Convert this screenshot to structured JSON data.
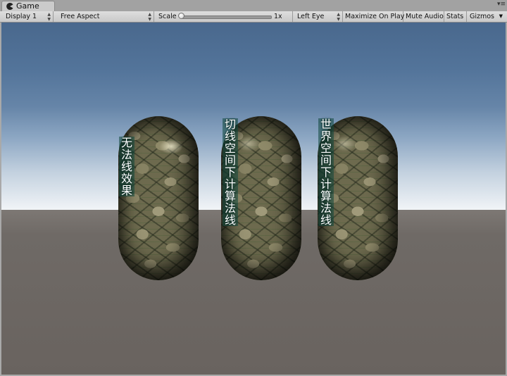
{
  "tab": {
    "title": "Game",
    "icon": "pacman-icon"
  },
  "toolbar": {
    "display": "Display 1",
    "aspect": "Free Aspect",
    "scale_label": "Scale",
    "scale_value": "1x",
    "scale_fraction": 0.0,
    "eye": "Left Eye",
    "maximize": "Maximize On Play",
    "mute": "Mute Audio",
    "stats": "Stats",
    "gizmos": "Gizmos"
  },
  "scene": {
    "labels": [
      "无法线效果",
      "切线空间下计算法线",
      "世界空间下计算法线"
    ]
  }
}
